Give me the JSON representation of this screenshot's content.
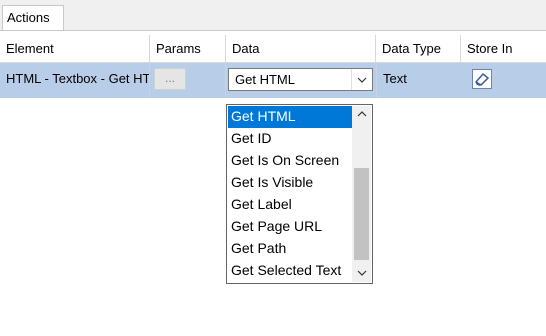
{
  "tab": {
    "label": "Actions"
  },
  "columns": [
    "Element",
    "Params",
    "Data",
    "Data Type",
    "Store In"
  ],
  "row": {
    "element": "HTML - Textbox - Get HTML",
    "params_button": "...",
    "data_value": "Get HTML",
    "data_type": "Text"
  },
  "dropdown": {
    "options": [
      "Get HTML",
      "Get ID",
      "Get Is On Screen",
      "Get Is Visible",
      "Get Label",
      "Get Page URL",
      "Get Path",
      "Get Selected Text"
    ],
    "selected_index": 0
  },
  "icons": {
    "combo_arrow": "chevron-down-icon",
    "scroll_up": "chevron-up-icon",
    "scroll_down": "chevron-down-icon",
    "store_in": "eraser-icon"
  },
  "colors": {
    "selected_row": "#b8cde8",
    "highlight": "#0078d7"
  }
}
